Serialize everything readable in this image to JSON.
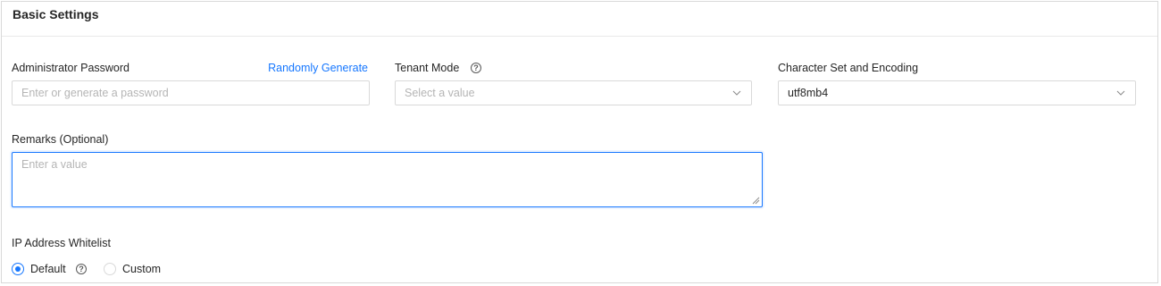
{
  "section": {
    "title": "Basic Settings"
  },
  "admin_password": {
    "label": "Administrator Password",
    "generate_link": "Randomly Generate",
    "placeholder": "Enter or generate a password"
  },
  "tenant_mode": {
    "label": "Tenant Mode",
    "help_icon": "question-circle-icon",
    "placeholder": "Select a value"
  },
  "charset": {
    "label": "Character Set and Encoding",
    "value": "utf8mb4"
  },
  "remarks": {
    "label": "Remarks (Optional)",
    "placeholder": "Enter a value"
  },
  "ip_whitelist": {
    "label": "IP Address Whitelist",
    "options": [
      {
        "label": "Default",
        "selected": true
      },
      {
        "label": "Custom",
        "selected": false
      }
    ]
  },
  "colors": {
    "accent": "#1677ff",
    "border": "#d9d9d9",
    "placeholder": "#b5b5b5"
  }
}
